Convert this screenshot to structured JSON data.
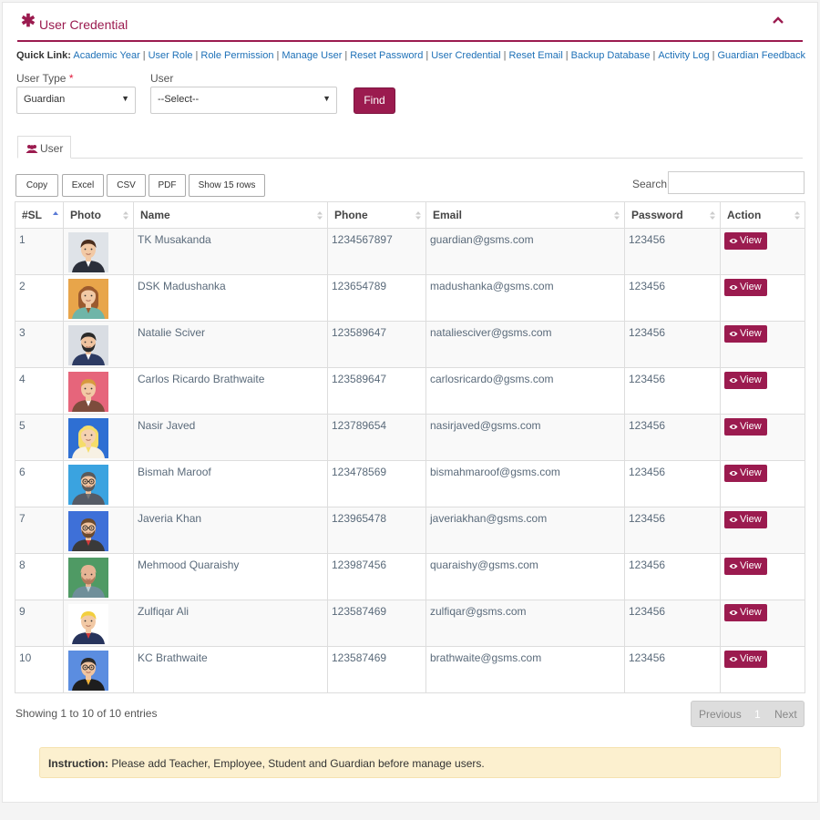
{
  "panel": {
    "title": "User Credential"
  },
  "quick_links": {
    "label": "Quick Link:",
    "items": [
      {
        "label": "Academic Year"
      },
      {
        "label": "User Role"
      },
      {
        "label": "Role Permission"
      },
      {
        "label": "Manage User"
      },
      {
        "label": "Reset Password"
      },
      {
        "label": "User Credential"
      },
      {
        "label": "Reset Email"
      },
      {
        "label": "Backup Database"
      },
      {
        "label": "Activity Log"
      },
      {
        "label": "Guardian Feedback"
      }
    ]
  },
  "filters": {
    "user_type_label": "User Type",
    "required_mark": "*",
    "user_type_value": "Guardian",
    "user_label": "User",
    "user_value": "--Select--",
    "find_label": "Find"
  },
  "tab": {
    "label": "User"
  },
  "export_buttons": {
    "copy": "Copy",
    "excel": "Excel",
    "csv": "CSV",
    "pdf": "PDF",
    "rows": "Show 15 rows"
  },
  "search": {
    "label": "Search:"
  },
  "table": {
    "headers": {
      "sl": "#SL",
      "photo": "Photo",
      "name": "Name",
      "phone": "Phone",
      "email": "Email",
      "password": "Password",
      "action": "Action"
    },
    "view_label": "View",
    "rows": [
      {
        "sl": "1",
        "name": "TK Musakanda",
        "phone": "1234567897",
        "email": "guardian@gsms.com",
        "password": "123456",
        "avatar": "man-brown-hair-avatar"
      },
      {
        "sl": "2",
        "name": "DSK Madushanka",
        "phone": "123654789",
        "email": "madushanka@gsms.com",
        "password": "123456",
        "avatar": "woman-brown-hair-avatar"
      },
      {
        "sl": "3",
        "name": "Natalie Sciver",
        "phone": "123589647",
        "email": "nataliesciver@gsms.com",
        "password": "123456",
        "avatar": "bearded-man-suit-avatar"
      },
      {
        "sl": "4",
        "name": "Carlos Ricardo Brathwaite",
        "phone": "123589647",
        "email": "carlosricardo@gsms.com",
        "password": "123456",
        "avatar": "woman-blonde-pink-bg-avatar"
      },
      {
        "sl": "5",
        "name": "Nasir Javed",
        "phone": "123789654",
        "email": "nasirjaved@gsms.com",
        "password": "123456",
        "avatar": "blonde-woman-blue-bg-avatar"
      },
      {
        "sl": "6",
        "name": "Bismah Maroof",
        "phone": "123478569",
        "email": "bismahmaroof@gsms.com",
        "password": "123456",
        "avatar": "man-glasses-beard-avatar"
      },
      {
        "sl": "7",
        "name": "Javeria Khan",
        "phone": "123965478",
        "email": "javeriakhan@gsms.com",
        "password": "123456",
        "avatar": "man-glasses-red-tie-avatar"
      },
      {
        "sl": "8",
        "name": "Mehmood Quaraishy",
        "phone": "123987456",
        "email": "quaraishy@gsms.com",
        "password": "123456",
        "avatar": "bald-man-green-bg-avatar"
      },
      {
        "sl": "9",
        "name": "Zulfiqar Ali",
        "phone": "123587469",
        "email": "zulfiqar@gsms.com",
        "password": "123456",
        "avatar": "blond-man-red-tie-avatar"
      },
      {
        "sl": "10",
        "name": "KC Brathwaite",
        "phone": "123587469",
        "email": "brathwaite@gsms.com",
        "password": "123456",
        "avatar": "man-glasses-blue-bg-avatar"
      }
    ]
  },
  "footer": {
    "info": "Showing 1 to 10 of 10 entries",
    "previous": "Previous",
    "page": "1",
    "next": "Next"
  },
  "instruction": {
    "label": "Instruction:",
    "text": "Please add Teacher, Employee, Student and Guardian before manage users."
  },
  "colors": {
    "accent": "#9b1b4f",
    "link": "#1d70b7",
    "instruction_bg": "#fcf0cf"
  }
}
